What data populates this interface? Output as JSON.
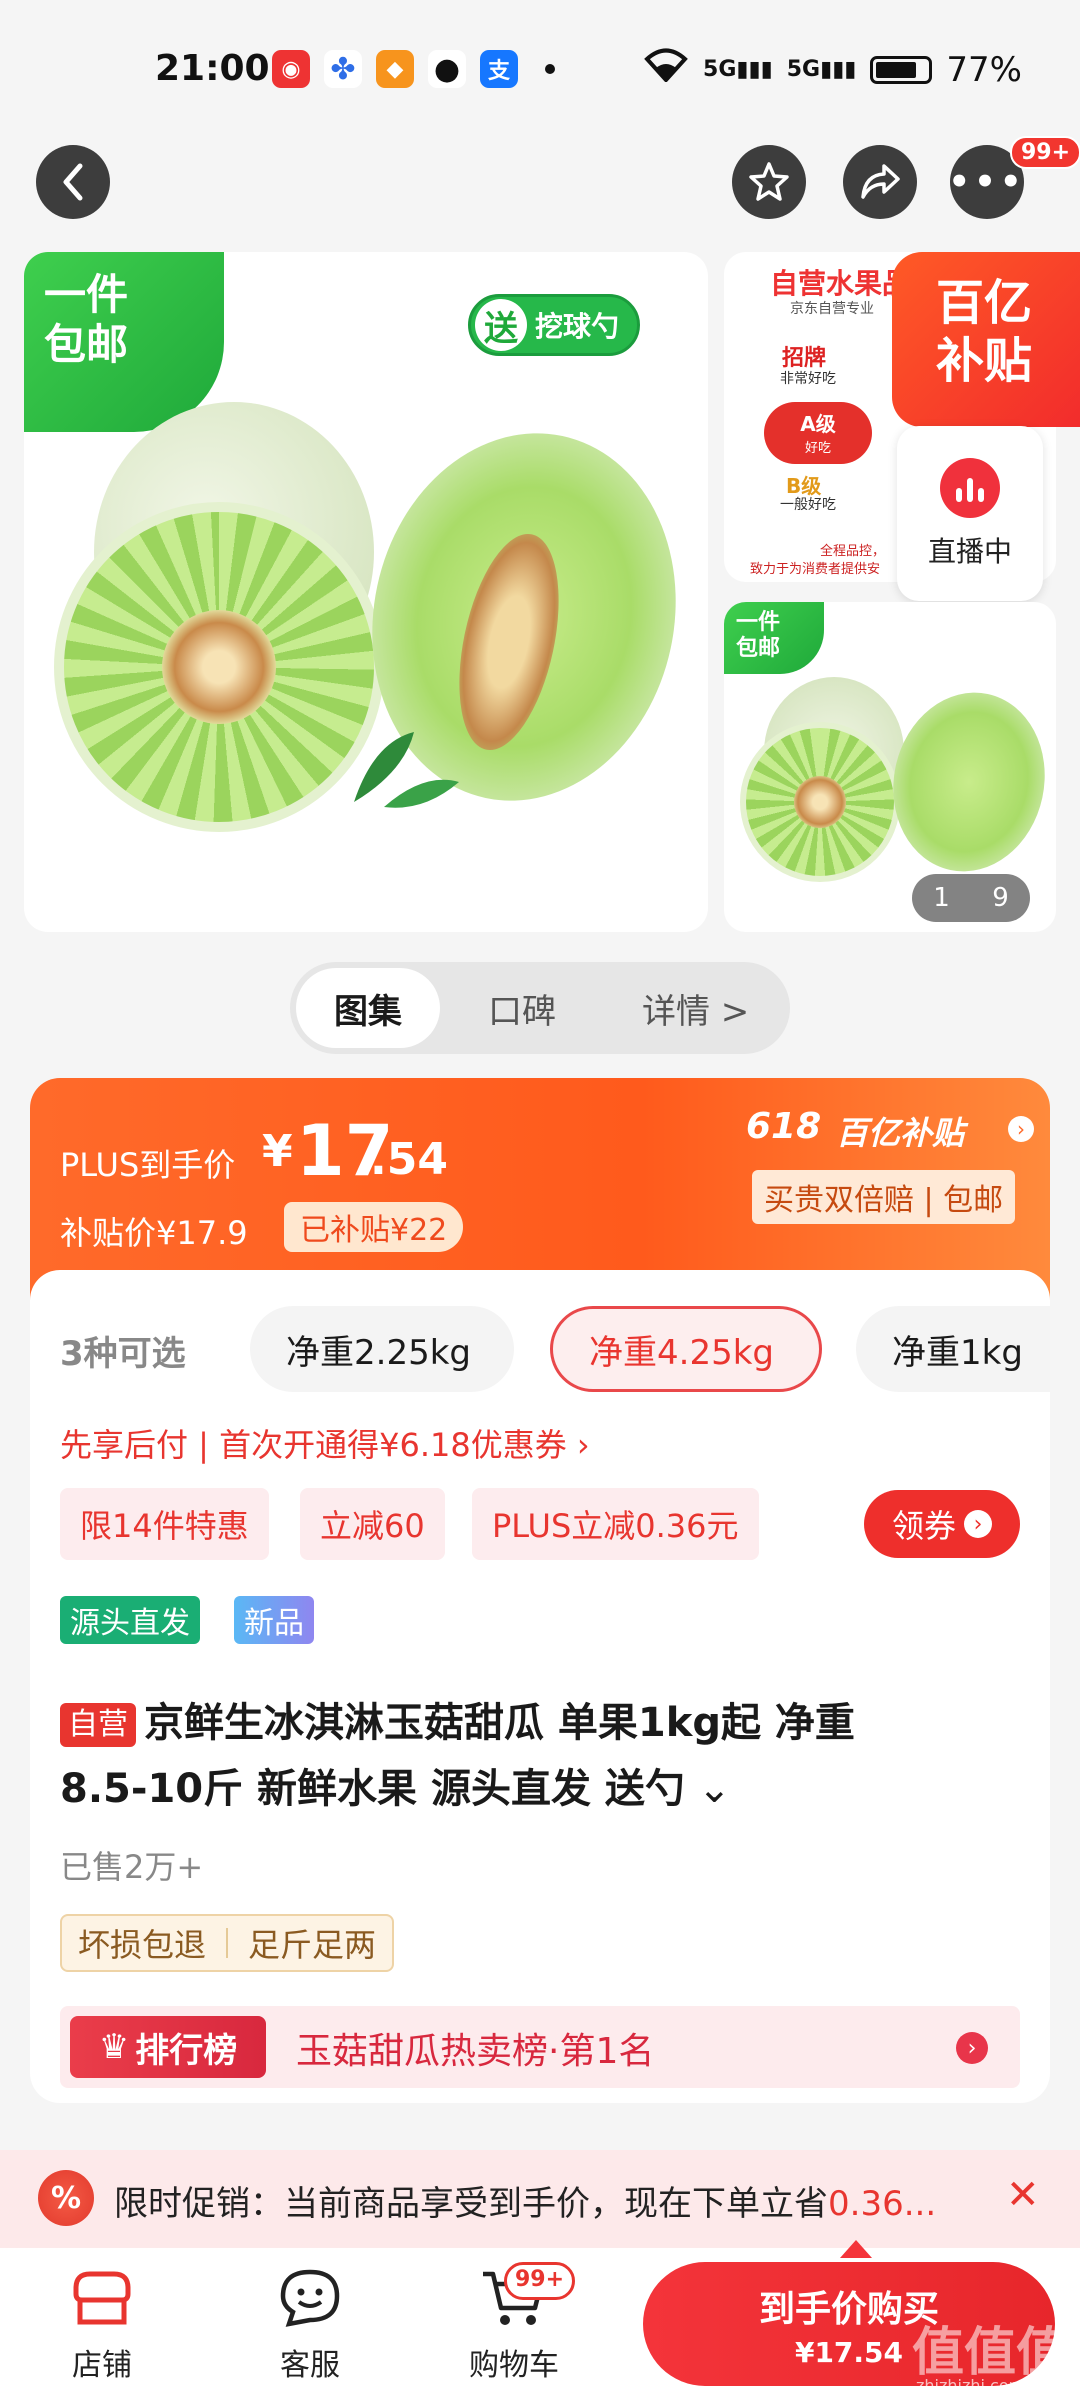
{
  "status_bar": {
    "time": "21:00",
    "network1": "5G",
    "network2": "5G",
    "battery": "77%",
    "app_icons": [
      "jd-icon",
      "baidu-icon",
      "app-orange-icon",
      "wechat-icon",
      "alipay-icon"
    ],
    "alipay_char": "支"
  },
  "nav": {
    "badge": "99+"
  },
  "gallery": {
    "main_tag": "一件\n包邮",
    "main_tag_line1": "一件",
    "main_tag_line2": "包邮",
    "gift_badge_char": "送",
    "gift_badge_text": "挖球勺",
    "side1": {
      "title": "自营水果品",
      "subtitle": "京东自营专业",
      "grade1": "招牌",
      "grade1_sub": "非常好吃",
      "grade2": "A级",
      "grade2_sub": "好吃",
      "grade3": "B级",
      "grade3_sub": "一般好吃",
      "footer1": "全程品控，",
      "footer2": "致力于为消费者提供安"
    },
    "subsidy_line1": "百亿",
    "subsidy_line2": "补贴",
    "live_label": "直播中",
    "side2_tag_line1": "一件",
    "side2_tag_line2": "包邮",
    "page_current": "1",
    "page_total": "9"
  },
  "tabs": [
    {
      "label": "图集",
      "active": true
    },
    {
      "label": "口碑",
      "active": false
    },
    {
      "label": "详情 >",
      "active": false
    }
  ],
  "price": {
    "plus_label": "PLUS到手价",
    "currency": "¥",
    "integer": "17",
    "decimal": ".54",
    "subsidy_price": "补贴价¥17.9",
    "subsidized": "已补贴¥22",
    "event": "618",
    "event_brand": "百亿补贴",
    "guarantee": "买贵双倍赔 | 包邮"
  },
  "options": {
    "count_label": "3种可选",
    "items": [
      {
        "label": "净重2.25kg",
        "selected": false
      },
      {
        "label": "净重4.25kg",
        "selected": true
      },
      {
        "label": "净重1kg",
        "selected": false
      }
    ]
  },
  "pay_later": "先享后付 | 首次开通得¥6.18优惠券 ›",
  "promos": [
    "限14件特惠",
    "立减60",
    "PLUS立减0.36元"
  ],
  "coupon_button": "领券",
  "tags": [
    "源头直发",
    "新品"
  ],
  "product": {
    "self_run": "自营",
    "title_line1": "京鲜生冰淇淋玉菇甜瓜 单果1kg起 净重",
    "title_line2": "8.5-10斤 新鲜水果 源头直发 送勺",
    "sold": "已售2万+",
    "services": [
      "坏损包退",
      "足斤足两"
    ]
  },
  "ranking": {
    "label": "排行榜",
    "text": "玉菇甜瓜热卖榜·第1名"
  },
  "promo_bar": {
    "prefix": "限时促销：当前商品享受到手价，现在下单立省",
    "highlight": "0.36..."
  },
  "bottom": {
    "shop": "店铺",
    "service": "客服",
    "cart": "购物车",
    "cart_badge": "99+",
    "buy_label": "到手价购买",
    "buy_price": "¥17.54"
  },
  "watermark": {
    "text": "值值值",
    "domain": "zhizhizhi.com"
  },
  "colors": {
    "accent_red": "#e8352f",
    "orange": "#ff6a2a",
    "green": "#1fb36b"
  }
}
